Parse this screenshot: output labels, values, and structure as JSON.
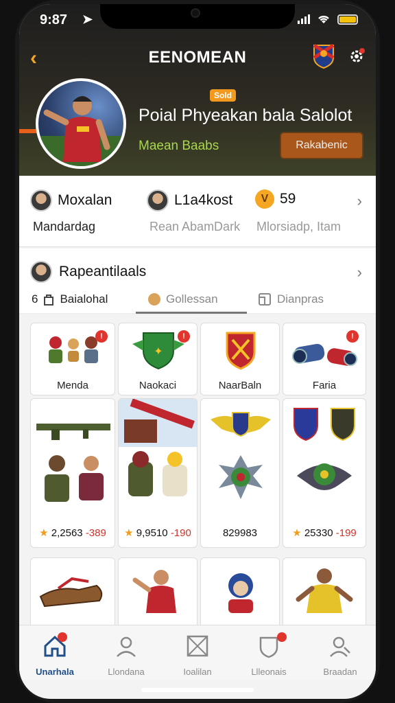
{
  "status": {
    "time": "9:87"
  },
  "header": {
    "title": "EENOMEAN",
    "back_icon": "chevron-left-icon",
    "crest_icon": "team-crest-icon",
    "settings_icon": "gear-icon"
  },
  "profile": {
    "badge": "Sold",
    "title": "Poial Phyeakan bala Salolot",
    "subtitle": "Maean Baabs",
    "action_label": "Rakabenic"
  },
  "stats": {
    "items": [
      {
        "value": "Moxalan",
        "sub": "Mandardag"
      },
      {
        "value": "L1a4kost",
        "sub": "Rean AbamDark"
      },
      {
        "value": "59",
        "sub": "Mlorsiadp, Itam"
      }
    ]
  },
  "section": {
    "title": "Rapeantilaals",
    "tabs": [
      {
        "label": "Baialohal",
        "prefix": "6"
      },
      {
        "label": "Gollessan"
      },
      {
        "label": "Dianpras"
      }
    ]
  },
  "items_row1": [
    {
      "label": "Menda"
    },
    {
      "label": "Naokaci"
    },
    {
      "label": "NaarBaln"
    },
    {
      "label": "Faria"
    }
  ],
  "items_row2": [
    {
      "price_main": "2,2563 ",
      "price_red": "-389"
    },
    {
      "price_main": "9,9510 ",
      "price_red": "-190"
    },
    {
      "price_main": "829983",
      "price_red": ""
    },
    {
      "price_main": "25330 ",
      "price_red": "-199"
    }
  ],
  "nav": [
    {
      "label": "Unarhala",
      "icon": "home-icon",
      "active": true
    },
    {
      "label": "Llondana",
      "icon": "profile-icon"
    },
    {
      "label": "Ioalilan",
      "icon": "inbox-icon"
    },
    {
      "label": "Llleonais",
      "icon": "shield-icon"
    },
    {
      "label": "Braadan",
      "icon": "user-search-icon"
    }
  ],
  "colors": {
    "accent": "#f5a623",
    "badge_red": "#e0342c",
    "nav_active": "#1f4f8a"
  }
}
